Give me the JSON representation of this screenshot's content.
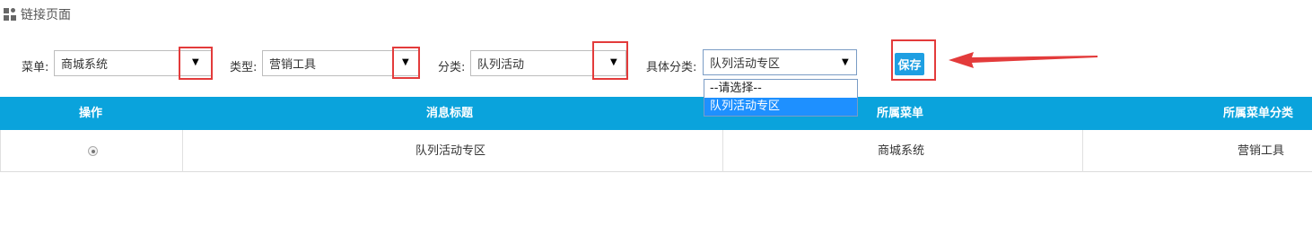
{
  "page": {
    "title": "链接页面"
  },
  "filters": {
    "menu_label": "菜单:",
    "menu_value": "商城系统",
    "type_label": "类型:",
    "type_value": "营销工具",
    "category_label": "分类:",
    "category_value": "队列活动",
    "subcategory_label": "具体分类:",
    "subcategory_value": "队列活动专区",
    "arrow_glyph": "▼"
  },
  "dropdown": {
    "options": [
      "--请选择--",
      "队列活动专区"
    ],
    "selected_index": 1
  },
  "toolbar": {
    "save_label": "保存"
  },
  "table": {
    "columns": [
      "操作",
      "消息标题",
      "所属菜单",
      "所属菜单分类"
    ],
    "rows": [
      {
        "title": "队列活动专区",
        "menu": "商城系统",
        "menu_category": "营销工具",
        "selected": true
      }
    ]
  },
  "colors": {
    "header_bg": "#0aa3dc",
    "save_button": "#1e9fe2",
    "annotation_red": "#e33b3b",
    "selected_option": "#1e90ff"
  },
  "icons": [
    "grid-icon",
    "chevron-down-icon",
    "radio-icon",
    "arrow-annotation"
  ]
}
